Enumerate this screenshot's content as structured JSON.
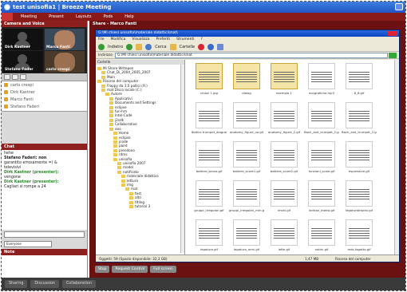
{
  "window": {
    "title": "test unisofia1 | Breeze Meeting"
  },
  "menu": {
    "items": [
      "Meeting",
      "Present",
      "Layouts",
      "Pods",
      "Help"
    ]
  },
  "left": {
    "camera_title": "Camera and Voice",
    "videos": [
      {
        "name": "Dirk Kastner"
      },
      {
        "name": "Marco Fanti"
      },
      {
        "name": "Stefano Fader"
      },
      {
        "name": "carlo crespi"
      }
    ],
    "users": [
      "carlo crespi",
      "Dirk Kastner",
      "Marco Fanti",
      "Stefano Faderi"
    ],
    "chat_title": "Chat",
    "chat_lines": [
      "hehe",
      "Stefano Faderi: non",
      "garantito errosamente =) &",
      "televisivi",
      "Dirk Kastner (presenter):",
      "vengone",
      "Dirk Kastner (presenter):",
      "Cagliari si rompe a 24"
    ],
    "chat_select": "Everyone",
    "notes_title": "Note"
  },
  "share": {
    "title": "Share - Marco Fanti",
    "explorer_title": "G:\\Mi chiesi unisofia\\materiale didattici\\mat\\",
    "explorer_menu": [
      "File",
      "Modifica",
      "Visualizza",
      "Preferiti",
      "Strumenti",
      "?"
    ],
    "toolbar": {
      "back": "Indietro",
      "search": "Cerca",
      "folders": "Cartelle"
    },
    "address_label": "Indirizzo",
    "address_value": "G:\\Mi chiesi unisofia\\materiale didattici\\mat",
    "tree_title": "Cartelle",
    "tree_nodes": [
      "Mi Share Writepen",
      "Chat_Di_2004_2005_2007",
      "Main",
      "Risorse del computer",
      "Floppy da 3,5 pollici (A:)",
      "mat Disco locale (C:)",
      "Autore",
      "Applicativi",
      "Documents and Settings",
      "eclipse",
      "fun-hm",
      "Intel-Code",
      "j2sdk",
      "Collaborative",
      "ooo",
      "Home",
      "eclipse",
      "jcode",
      "paint",
      "prendono",
      "rdms",
      "unisofia",
      "unisofia 2007",
      "model",
      "notificato",
      "materiale didattico",
      "lettura",
      "img",
      "mat",
      "test",
      "altri",
      "titling",
      "tutorial 3"
    ],
    "files": [
      "chiavi 1.jpg",
      "dialog",
      "esempio 1",
      "ecografiche.mp3",
      "8_6.gif",
      "8bitics trumpet_diagram.gif",
      "anatomy_figure_no.gif",
      "anatomy_figure_2.gif",
      "Bach_and_trumpet_2.gif",
      "Bach_and_trumpet_2.gif",
      "battere_bravo.gif",
      "battere_score1.gif",
      "battere_score2.gif",
      "funzioni_scale.gif",
      "espressive.gif",
      "gruppi_irregolari.gif",
      "gruppi_irregolari_mm.gif",
      "imshi.gif",
      "indicaz_metro.gif",
      "legaturatriplex.gif",
      "legature.gif",
      "legatura_mmi.gif",
      "lefte.gif",
      "notini.gif",
      "mds-fagotto.gif"
    ],
    "status_left": "Oggetti: 59 (Spazio disponibile: 32,3 GB)",
    "status_size": "1,47 MB",
    "status_right": "Risorse del computer",
    "bottom_buttons": [
      "Stop",
      "Request Control",
      "Full screen"
    ]
  },
  "footer": {
    "tabs": [
      "Sharing",
      "Discussion",
      "Collaboration"
    ]
  }
}
